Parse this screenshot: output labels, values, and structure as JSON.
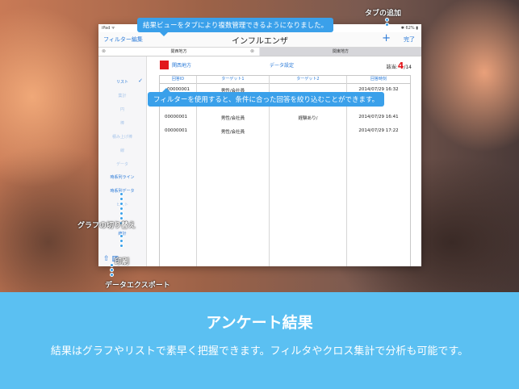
{
  "status": {
    "left": "iPad ᯤ",
    "time": "",
    "right": "✱ 62% ▮"
  },
  "nav": {
    "left": "フィルター編集",
    "title": "インフルエンザ",
    "plus": "+",
    "done": "完了"
  },
  "tabs": [
    {
      "label": "関西地方",
      "close": "⊗"
    },
    {
      "label": "関東地方",
      "close": "⊗"
    }
  ],
  "sidebar": {
    "items": [
      "リスト",
      "集計",
      "円",
      "棒",
      "積み上げ棒",
      "線",
      "データ",
      "時系列ライン",
      "時系列データ",
      "ヒスト",
      "統計"
    ],
    "check": "✓",
    "icons": "⇧  ▥"
  },
  "content": {
    "region": "関西地方",
    "data_settings": "データ設定",
    "count_prefix": "該当:",
    "count_value": "4",
    "count_total": "/14"
  },
  "table": {
    "headers": [
      "回答ID",
      "ターゲット1",
      "ターゲット2",
      "回答時刻"
    ],
    "rows": [
      [
        "00000001",
        "男性/会社員",
        "経験あり/",
        "2014/07/29 16:41"
      ],
      [
        "00000001",
        "男性/会社員",
        "",
        "2014/07/29 17:22"
      ]
    ],
    "hidden_row": [
      "00000001",
      "男性/会社員",
      "",
      "2014/07/29 16:32"
    ]
  },
  "callouts": {
    "top": "結果ビューをタブにより複数管理できるようになりました。",
    "middle": "フィルターを使用すると、条件に合った回答を絞り込むことができます。"
  },
  "labels": {
    "tab_add": "タブの追加",
    "graph_switch": "グラフの切り替え",
    "print": "印刷",
    "export": "データエクスポート"
  },
  "banner": {
    "title": "アンケート結果",
    "subtitle": "結果はグラフやリストで素早く把握できます。フィルタやクロス集計で分析も可能です。"
  },
  "colors": {
    "accent": "#3aa0ea",
    "banner": "#5bc0f2",
    "count_red": "#e2171c"
  }
}
